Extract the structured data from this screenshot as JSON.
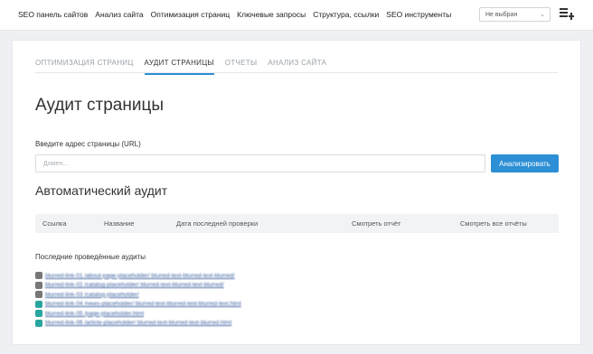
{
  "topbar": {
    "nav": [
      "SEO панель сайтов",
      "Анализ сайта",
      "Оптимизация страниц",
      "Ключевые запросы",
      "Структура, ссылки",
      "SEO инструменты"
    ],
    "select_value": "Не выбран"
  },
  "tabs": [
    "ОПТИМИЗАЦИЯ СТРАНИЦ",
    "АУДИТ СТРАНИЦЫ",
    "ОТЧЕТЫ",
    "АНАЛИЗ САЙТА"
  ],
  "active_tab": "АУДИТ СТРАНИЦЫ",
  "page_title": "Аудит страницы",
  "url_form": {
    "label": "Введите адрес страницы (URL)",
    "placeholder": "Домен...",
    "value": "",
    "button": "Анализировать"
  },
  "auto_audit": {
    "title": "Автоматический аудит",
    "columns": [
      "Ссылка",
      "Название",
      "Дата последней проверки",
      "Смотреть отчёт",
      "Смотреть все отчёты"
    ]
  },
  "recent": {
    "label": "Последние проведённые аудиты",
    "items": [
      {
        "icon": "lock-icon",
        "url": "blurred-link-01 /about-page-placeholder/ blurred-text-blurred-text-blurred/"
      },
      {
        "icon": "lock-icon",
        "url": "blurred-link-02 /catalog-placeholder/ blurred-text-blurred-text-blurred/"
      },
      {
        "icon": "lock-icon",
        "url": "blurred-link-03 /catalog-placeholder/"
      },
      {
        "icon": "printer-icon",
        "url": "blurred-link-04 /news-placeholder/ blurred-text-blurred-text-blurred-text.html"
      },
      {
        "icon": "printer-icon",
        "url": "blurred-link-05 /page-placeholder.html"
      },
      {
        "icon": "printer-icon",
        "url": "blurred-link-06 /article-placeholder/ blurred-text-blurred-text-blurred.html"
      }
    ]
  },
  "colors": {
    "accent": "#2d8fd5",
    "link": "#3b5f9e",
    "lock_icon": "#777777",
    "printer_icon": "#2aa6a0"
  }
}
